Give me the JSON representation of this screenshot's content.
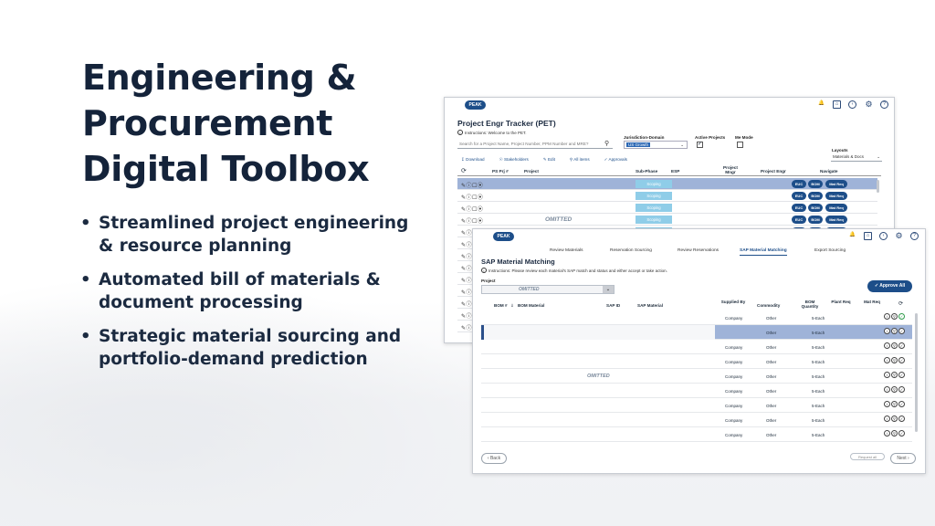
{
  "headline": [
    "Engineering &",
    "Procurement",
    "Digital Toolbox"
  ],
  "bullets": [
    [
      "Streamlined project engineering",
      "& resource planning"
    ],
    [
      "Automated bill of materials &",
      "document processing"
    ],
    [
      "Strategic material sourcing and",
      "portfolio-demand prediction"
    ]
  ],
  "brand": "PEAK",
  "icons": [
    "bell-icon",
    "home-icon",
    "back-icon",
    "gear-icon",
    "help-icon"
  ],
  "pet": {
    "title": "Project Engr Tracker (PET)",
    "instructions": "Instructions: Welcome to the PET.",
    "search_placeholder": "Search for a Project Name, Project Number, PPM Number and MRE?",
    "jurisdiction_label": "Jurisdiction-Domain",
    "jurisdiction_value": "US Growth",
    "active_projects_label": "Active Projects",
    "me_mode_label": "Me Mode",
    "layouts_label": "Layouts",
    "layouts_value": "Materials & Docs",
    "toolbar": [
      "Download",
      "Stakeholders",
      "Edit",
      "All items",
      "Approvals"
    ],
    "columns": [
      "PS Prj #",
      "Project",
      "Sub-Phase",
      "ESP",
      "Project Mngr",
      "Project Engr",
      "Navigate"
    ],
    "phase": "Scoping",
    "nav_buttons": [
      "EUC",
      "BOM",
      "Mat Req"
    ],
    "omitted": "OMITTED"
  },
  "sap": {
    "tabs": [
      "Review Materials",
      "Reservation Sourcing",
      "Review Reservations",
      "SAP Material Matching",
      "Export Sourcing"
    ],
    "active_tab": "SAP Material Matching",
    "title": "SAP Material Matching",
    "instructions": "Instructions: Please review each material's SAP match and status and either accept or take action.",
    "project_label": "Project",
    "project_value": "OMITTED",
    "approve_all": "Approve All",
    "columns": [
      "BOM #",
      "BOM Material",
      "SAP ID",
      "SAP Material",
      "Supplied By",
      "Commodity",
      "BOM Quantity",
      "Plant Req",
      "Mat Req"
    ],
    "rows": [
      {
        "supplied_by": "Company",
        "commodity": "Other",
        "quantity": "5-Each"
      },
      {
        "supplied_by": "",
        "commodity": "Other",
        "quantity": "5-Each"
      },
      {
        "supplied_by": "Company",
        "commodity": "Other",
        "quantity": "5-Each"
      },
      {
        "supplied_by": "Company",
        "commodity": "Other",
        "quantity": "5-Each"
      },
      {
        "supplied_by": "Company",
        "commodity": "Other",
        "quantity": "5-Each"
      },
      {
        "supplied_by": "Company",
        "commodity": "Other",
        "quantity": "5-Each"
      },
      {
        "supplied_by": "Company",
        "commodity": "Other",
        "quantity": "5-Each"
      },
      {
        "supplied_by": "Company",
        "commodity": "Other",
        "quantity": "5-Each"
      },
      {
        "supplied_by": "Company",
        "commodity": "Other",
        "quantity": "5-Each"
      }
    ],
    "omitted": "OMITTED",
    "back": "Back",
    "request_all": "Request all",
    "next": "Next"
  },
  "colors": {
    "navy": "#14233a",
    "brand": "#1d4e89",
    "selected_row": "#9fb3d8",
    "phase": "#8fcde8"
  }
}
